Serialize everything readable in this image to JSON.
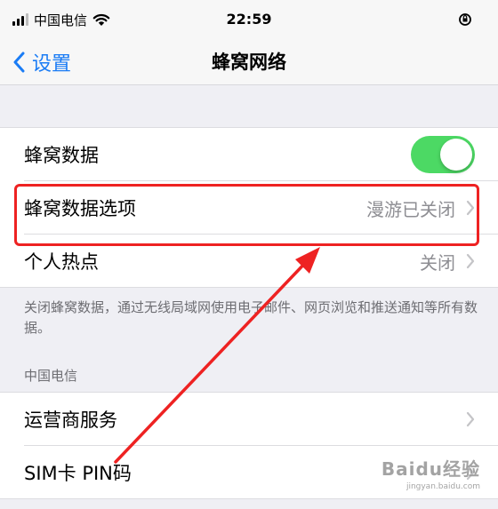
{
  "status_bar": {
    "carrier": "中国电信",
    "time": "22:59",
    "icons": [
      "signal-icon",
      "wifi-icon",
      "orientation-lock-icon"
    ]
  },
  "nav": {
    "back_label": "设置",
    "title": "蜂窝网络"
  },
  "group1": {
    "rows": [
      {
        "label": "蜂窝数据",
        "toggle_on": true
      },
      {
        "label": "蜂窝数据选项",
        "value": "漫游已关闭"
      },
      {
        "label": "个人热点",
        "value": "关闭"
      }
    ],
    "footnote": "关闭蜂窝数据，通过无线局域网使用电子邮件、网页浏览和推送通知等所有数据。"
  },
  "section2": {
    "header": "中国电信",
    "rows": [
      {
        "label": "运营商服务"
      },
      {
        "label": "SIM卡 PIN码"
      }
    ]
  },
  "watermark": {
    "logo": "Baidu经验",
    "sub": "jingyan.baidu.com"
  },
  "colors": {
    "accent": "#1a7cf5",
    "toggle_on": "#4cd964",
    "annotation": "#ee2222",
    "background": "#efeff4"
  }
}
